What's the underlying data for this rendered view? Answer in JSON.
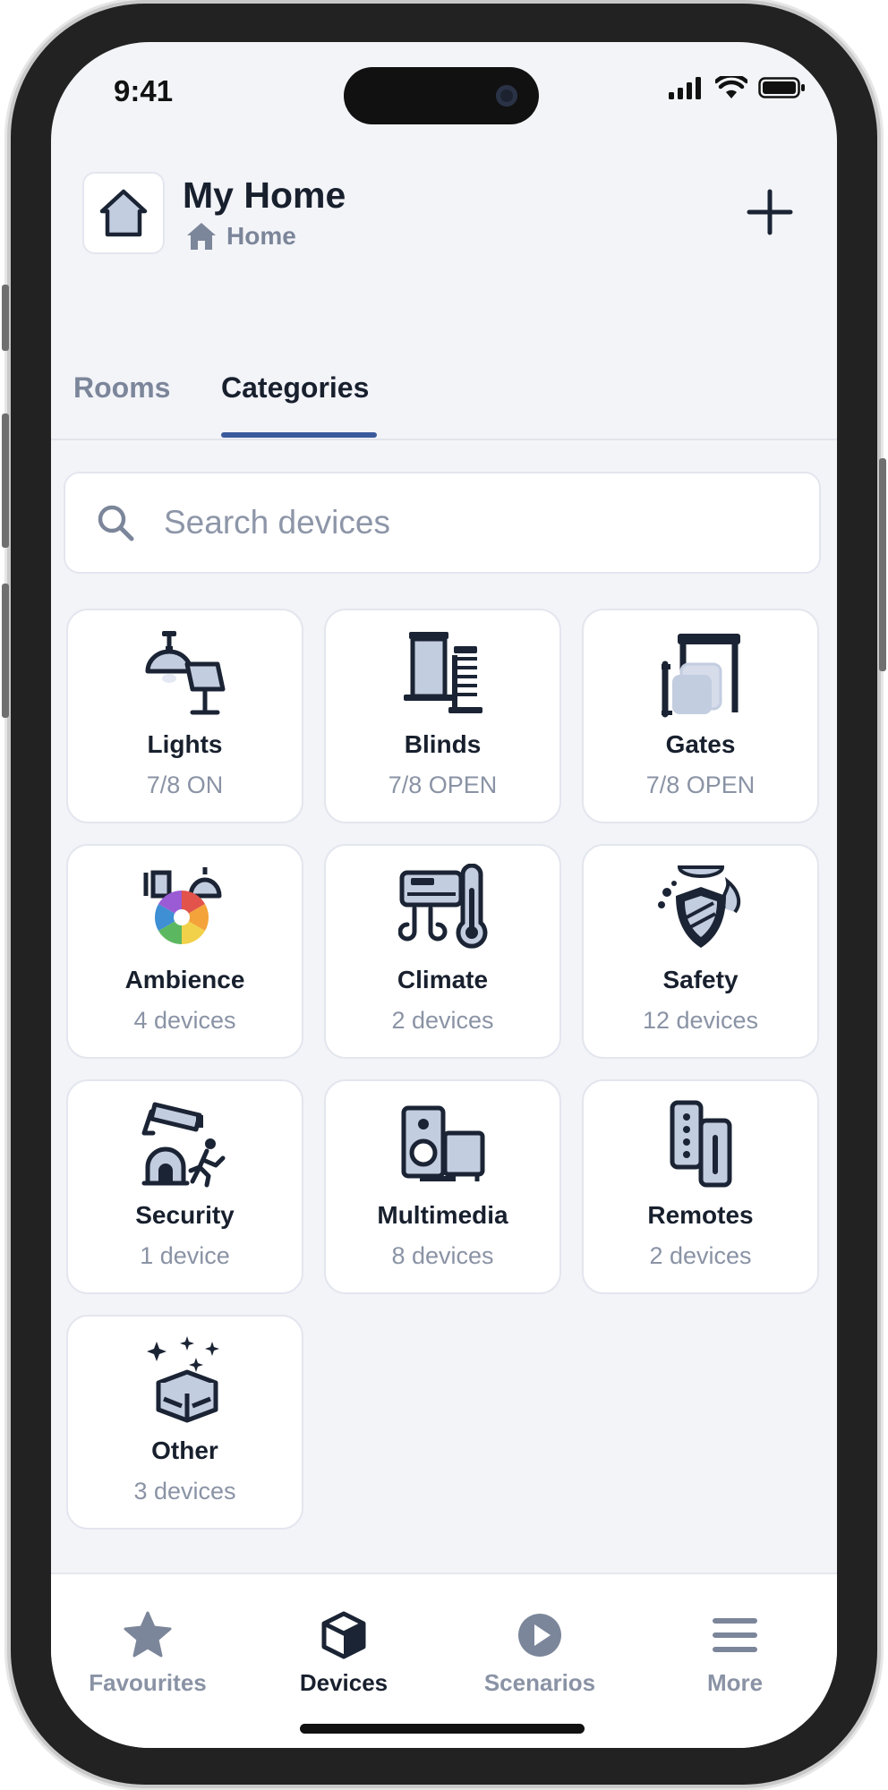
{
  "status_bar": {
    "time": "9:41"
  },
  "header": {
    "title": "My Home",
    "subtitle": "Home"
  },
  "tabs": [
    {
      "label": "Rooms",
      "active": false
    },
    {
      "label": "Categories",
      "active": true
    }
  ],
  "search": {
    "placeholder": "Search devices",
    "value": ""
  },
  "categories": [
    {
      "name": "Lights",
      "stat": "7/8 ON",
      "icon": "lights-icon"
    },
    {
      "name": "Blinds",
      "stat": "7/8 OPEN",
      "icon": "blinds-icon"
    },
    {
      "name": "Gates",
      "stat": "7/8 OPEN",
      "icon": "gates-icon"
    },
    {
      "name": "Ambience",
      "stat": "4 devices",
      "icon": "ambience-icon"
    },
    {
      "name": "Climate",
      "stat": "2 devices",
      "icon": "climate-icon"
    },
    {
      "name": "Safety",
      "stat": "12 devices",
      "icon": "safety-icon"
    },
    {
      "name": "Security",
      "stat": "1 device",
      "icon": "security-icon"
    },
    {
      "name": "Multimedia",
      "stat": "8 devices",
      "icon": "multimedia-icon"
    },
    {
      "name": "Remotes",
      "stat": "2 devices",
      "icon": "remotes-icon"
    },
    {
      "name": "Other",
      "stat": "3 devices",
      "icon": "other-icon"
    }
  ],
  "bottom_nav": [
    {
      "label": "Favourites",
      "icon": "star-icon",
      "active": false
    },
    {
      "label": "Devices",
      "icon": "cube-icon",
      "active": true
    },
    {
      "label": "Scenarios",
      "icon": "play-icon",
      "active": false
    },
    {
      "label": "More",
      "icon": "menu-icon",
      "active": false
    }
  ],
  "colors": {
    "accent": "#3a5a9c",
    "text_primary": "#18202e",
    "text_secondary": "#8a93a5",
    "icon_dark": "#1b2434",
    "icon_fill": "#c3cde0",
    "background": "#f3f4f8"
  }
}
